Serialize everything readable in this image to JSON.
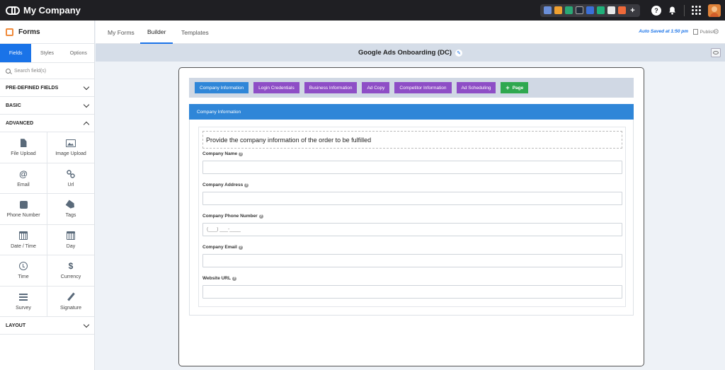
{
  "brand": {
    "name": "My Company"
  },
  "topbar": {
    "apps": [
      {
        "icon": "app-icon-1",
        "color": "#6b8fd9"
      },
      {
        "icon": "app-icon-2",
        "color": "#f0a030"
      },
      {
        "icon": "app-icon-3",
        "color": "#2aa876"
      },
      {
        "icon": "app-icon-4",
        "color": "#222a3a"
      },
      {
        "icon": "app-icon-5",
        "color": "#3b6fd8"
      },
      {
        "icon": "app-icon-6",
        "color": "#20b07a"
      },
      {
        "icon": "app-icon-7",
        "color": "#e8e8e8"
      },
      {
        "icon": "app-icon-8",
        "color": "#f06a3a"
      }
    ]
  },
  "sidebar": {
    "title": "Forms",
    "tabs": [
      "Fields",
      "Styles",
      "Options"
    ],
    "search_placeholder": "Search field(s)",
    "sections": {
      "predefined": "PRE-DEFINED FIELDS",
      "basic": "BASIC",
      "advanced": "ADVANCED",
      "layout": "LAYOUT"
    },
    "fields": [
      {
        "label": "File Upload",
        "icon": "file-icon"
      },
      {
        "label": "Image Upload",
        "icon": "image-icon"
      },
      {
        "label": "Email",
        "icon": "at-icon"
      },
      {
        "label": "Url",
        "icon": "link-icon"
      },
      {
        "label": "Phone Number",
        "icon": "phone-icon"
      },
      {
        "label": "Tags",
        "icon": "tag-icon"
      },
      {
        "label": "Date / Time",
        "icon": "calendar-icon"
      },
      {
        "label": "Day",
        "icon": "calendar-icon"
      },
      {
        "label": "Time",
        "icon": "clock-icon"
      },
      {
        "label": "Currency",
        "icon": "dollar-icon"
      },
      {
        "label": "Survey",
        "icon": "list-icon"
      },
      {
        "label": "Signature",
        "icon": "pen-icon"
      }
    ]
  },
  "nav": {
    "tabs": [
      "My Forms",
      "Builder",
      "Templates"
    ],
    "active_tab": "Builder",
    "autosave": "Auto Saved at 1:50 pm",
    "publish": "Publish"
  },
  "form": {
    "title": "Google Ads Onboarding (DC)",
    "pages": [
      "Company Information",
      "Login Credentials",
      "Business Information",
      "Ad Copy",
      "Competitor Information",
      "Ad Scheduling"
    ],
    "add_page": "Page",
    "section_title": "Company Information",
    "intro": "Provide the company information of the order to be fulfilled",
    "fields": [
      {
        "label": "Company Name",
        "value": "",
        "placeholder": ""
      },
      {
        "label": "Company Address",
        "value": "",
        "placeholder": ""
      },
      {
        "label": "Company Phone Number",
        "value": "",
        "placeholder": "(___) ___-____"
      },
      {
        "label": "Company Email",
        "value": "",
        "placeholder": ""
      },
      {
        "label": "Website URL",
        "value": "",
        "placeholder": ""
      }
    ]
  },
  "colors": {
    "accent": "#1a73e8",
    "page_button": "#8e4ec6",
    "page_button_active": "#2f86d8",
    "add_page": "#2fa84f",
    "topbar": "#1f1f23"
  }
}
